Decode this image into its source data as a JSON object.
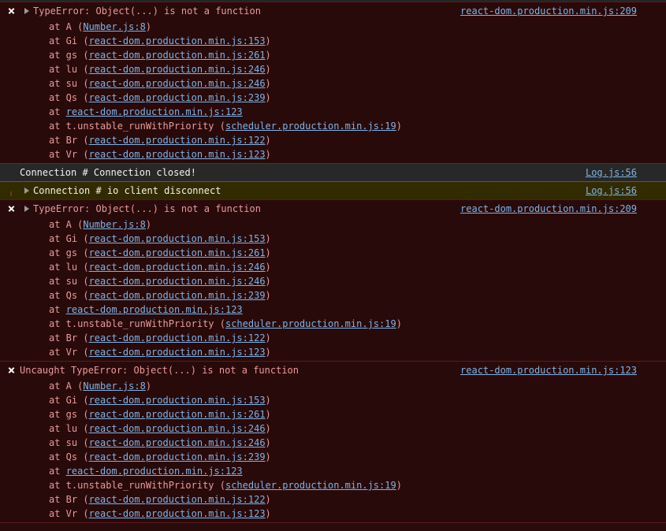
{
  "theme": {
    "error_bg": "#290a0a",
    "error_border": "#5c1a1a",
    "error_text": "#e79a9a",
    "info_bg": "#282828",
    "info_text": "#f1f1f1",
    "warning_bg": "#332b00",
    "warning_border": "#6b5c11",
    "warning_text": "#f3f3e8",
    "link": "#7fb2e4",
    "error_icon": "#d22424",
    "warning_icon": "#e8b423",
    "triangle": "#9a9a9a"
  },
  "icons": {
    "error": "error-circle-x-icon",
    "warning": "warning-triangle-icon",
    "expand": "expand-triangle-icon"
  },
  "messages": [
    {
      "level": "error",
      "expandable": true,
      "title": "TypeError: Object(...) is not a function",
      "source": "react-dom.production.min.js:209",
      "stack": [
        {
          "fn": "at A (",
          "link": "Number.js:8",
          "close": ")"
        },
        {
          "fn": "at Gi (",
          "link": "react-dom.production.min.js:153",
          "close": ")"
        },
        {
          "fn": "at gs (",
          "link": "react-dom.production.min.js:261",
          "close": ")"
        },
        {
          "fn": "at lu (",
          "link": "react-dom.production.min.js:246",
          "close": ")"
        },
        {
          "fn": "at su (",
          "link": "react-dom.production.min.js:246",
          "close": ")"
        },
        {
          "fn": "at Qs (",
          "link": "react-dom.production.min.js:239",
          "close": ")"
        },
        {
          "fn": "at ",
          "link": "react-dom.production.min.js:123",
          "close": ""
        },
        {
          "fn": "at t.unstable_runWithPriority (",
          "link": "scheduler.production.min.js:19",
          "close": ")"
        },
        {
          "fn": "at Br (",
          "link": "react-dom.production.min.js:122",
          "close": ")"
        },
        {
          "fn": "at Vr (",
          "link": "react-dom.production.min.js:123",
          "close": ")"
        }
      ]
    },
    {
      "level": "info",
      "expandable": false,
      "title": "Connection # Connection closed!",
      "source": "Log.js:56",
      "stack": []
    },
    {
      "level": "warning",
      "expandable": true,
      "title": "Connection # io client disconnect",
      "source": "Log.js:56",
      "stack": []
    },
    {
      "level": "error",
      "expandable": true,
      "title": "TypeError: Object(...) is not a function",
      "source": "react-dom.production.min.js:209",
      "stack": [
        {
          "fn": "at A (",
          "link": "Number.js:8",
          "close": ")"
        },
        {
          "fn": "at Gi (",
          "link": "react-dom.production.min.js:153",
          "close": ")"
        },
        {
          "fn": "at gs (",
          "link": "react-dom.production.min.js:261",
          "close": ")"
        },
        {
          "fn": "at lu (",
          "link": "react-dom.production.min.js:246",
          "close": ")"
        },
        {
          "fn": "at su (",
          "link": "react-dom.production.min.js:246",
          "close": ")"
        },
        {
          "fn": "at Qs (",
          "link": "react-dom.production.min.js:239",
          "close": ")"
        },
        {
          "fn": "at ",
          "link": "react-dom.production.min.js:123",
          "close": ""
        },
        {
          "fn": "at t.unstable_runWithPriority (",
          "link": "scheduler.production.min.js:19",
          "close": ")"
        },
        {
          "fn": "at Br (",
          "link": "react-dom.production.min.js:122",
          "close": ")"
        },
        {
          "fn": "at Vr (",
          "link": "react-dom.production.min.js:123",
          "close": ")"
        }
      ]
    },
    {
      "level": "error",
      "expandable": false,
      "title": "Uncaught TypeError: Object(...) is not a function",
      "source": "react-dom.production.min.js:123",
      "stack": [
        {
          "fn": "at A (",
          "link": "Number.js:8",
          "close": ")"
        },
        {
          "fn": "at Gi (",
          "link": "react-dom.production.min.js:153",
          "close": ")"
        },
        {
          "fn": "at gs (",
          "link": "react-dom.production.min.js:261",
          "close": ")"
        },
        {
          "fn": "at lu (",
          "link": "react-dom.production.min.js:246",
          "close": ")"
        },
        {
          "fn": "at su (",
          "link": "react-dom.production.min.js:246",
          "close": ")"
        },
        {
          "fn": "at Qs (",
          "link": "react-dom.production.min.js:239",
          "close": ")"
        },
        {
          "fn": "at ",
          "link": "react-dom.production.min.js:123",
          "close": ""
        },
        {
          "fn": "at t.unstable_runWithPriority (",
          "link": "scheduler.production.min.js:19",
          "close": ")"
        },
        {
          "fn": "at Br (",
          "link": "react-dom.production.min.js:122",
          "close": ")"
        },
        {
          "fn": "at Vr (",
          "link": "react-dom.production.min.js:123",
          "close": ")"
        }
      ]
    }
  ]
}
